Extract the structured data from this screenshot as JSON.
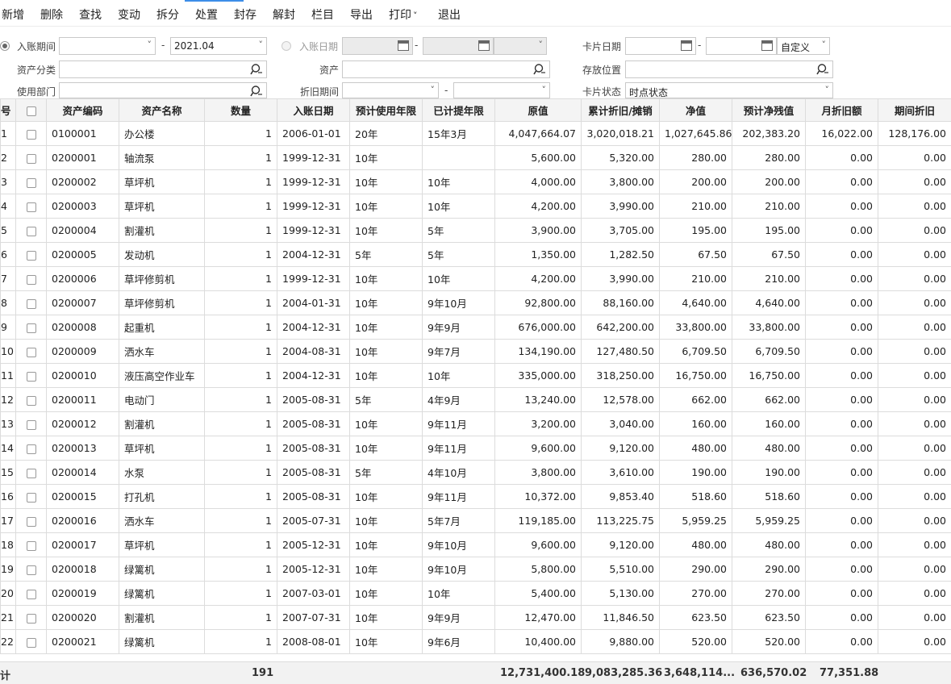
{
  "toolbar": {
    "add": "新增",
    "delete": "删除",
    "find": "查找",
    "change": "变动",
    "split": "拆分",
    "dispose": "处置",
    "seal": "封存",
    "unseal": "解封",
    "columns": "栏目",
    "export": "导出",
    "print": "打印",
    "exit": "退出"
  },
  "filters": {
    "entry_period_label": "入账期间",
    "entry_period_from": "",
    "entry_period_to": "2021.04",
    "entry_date_label": "入账日期",
    "entry_date_from": "",
    "entry_date_to": "",
    "card_date_label": "卡片日期",
    "card_date_from": "",
    "card_date_to": "",
    "card_date_mode": "自定义",
    "asset_category_label": "资产分类",
    "asset_category_value": "",
    "asset_label": "资产",
    "asset_value": "",
    "location_label": "存放位置",
    "location_value": "",
    "department_label": "使用部门",
    "department_value": "",
    "depr_period_label": "折旧期间",
    "depr_period_from": "",
    "depr_period_to": "",
    "card_status_label": "卡片状态",
    "card_status_value": "时点状态"
  },
  "table": {
    "headers": [
      "号",
      "",
      "资产编码",
      "资产名称",
      "数量",
      "入账日期",
      "预计使用年限",
      "已计提年限",
      "原值",
      "累计折旧/摊销",
      "净值",
      "预计净残值",
      "月折旧额",
      "期间折旧"
    ],
    "rows": [
      [
        "1",
        "0100001",
        "办公楼",
        "1",
        "2006-01-01",
        "20年",
        "15年3月",
        "4,047,664.07",
        "3,020,018.21",
        "1,027,645.86",
        "202,383.20",
        "16,022.00",
        "128,176.00"
      ],
      [
        "2",
        "0200001",
        "轴流泵",
        "1",
        "1999-12-31",
        "10年",
        "",
        "5,600.00",
        "5,320.00",
        "280.00",
        "280.00",
        "0.00",
        "0.00"
      ],
      [
        "3",
        "0200002",
        "草坪机",
        "1",
        "1999-12-31",
        "10年",
        "10年",
        "4,000.00",
        "3,800.00",
        "200.00",
        "200.00",
        "0.00",
        "0.00"
      ],
      [
        "4",
        "0200003",
        "草坪机",
        "1",
        "1999-12-31",
        "10年",
        "10年",
        "4,200.00",
        "3,990.00",
        "210.00",
        "210.00",
        "0.00",
        "0.00"
      ],
      [
        "5",
        "0200004",
        "割灌机",
        "1",
        "1999-12-31",
        "10年",
        "5年",
        "3,900.00",
        "3,705.00",
        "195.00",
        "195.00",
        "0.00",
        "0.00"
      ],
      [
        "6",
        "0200005",
        "发动机",
        "1",
        "2004-12-31",
        "5年",
        "5年",
        "1,350.00",
        "1,282.50",
        "67.50",
        "67.50",
        "0.00",
        "0.00"
      ],
      [
        "7",
        "0200006",
        "草坪修剪机",
        "1",
        "1999-12-31",
        "10年",
        "10年",
        "4,200.00",
        "3,990.00",
        "210.00",
        "210.00",
        "0.00",
        "0.00"
      ],
      [
        "8",
        "0200007",
        "草坪修剪机",
        "1",
        "2004-01-31",
        "10年",
        "9年10月",
        "92,800.00",
        "88,160.00",
        "4,640.00",
        "4,640.00",
        "0.00",
        "0.00"
      ],
      [
        "9",
        "0200008",
        "起重机",
        "1",
        "2004-12-31",
        "10年",
        "9年9月",
        "676,000.00",
        "642,200.00",
        "33,800.00",
        "33,800.00",
        "0.00",
        "0.00"
      ],
      [
        "10",
        "0200009",
        "洒水车",
        "1",
        "2004-08-31",
        "10年",
        "9年7月",
        "134,190.00",
        "127,480.50",
        "6,709.50",
        "6,709.50",
        "0.00",
        "0.00"
      ],
      [
        "11",
        "0200010",
        "液压高空作业车",
        "1",
        "2004-12-31",
        "10年",
        "10年",
        "335,000.00",
        "318,250.00",
        "16,750.00",
        "16,750.00",
        "0.00",
        "0.00"
      ],
      [
        "12",
        "0200011",
        "电动门",
        "1",
        "2005-08-31",
        "5年",
        "4年9月",
        "13,240.00",
        "12,578.00",
        "662.00",
        "662.00",
        "0.00",
        "0.00"
      ],
      [
        "13",
        "0200012",
        "割灌机",
        "1",
        "2005-08-31",
        "10年",
        "9年11月",
        "3,200.00",
        "3,040.00",
        "160.00",
        "160.00",
        "0.00",
        "0.00"
      ],
      [
        "14",
        "0200013",
        "草坪机",
        "1",
        "2005-08-31",
        "10年",
        "9年11月",
        "9,600.00",
        "9,120.00",
        "480.00",
        "480.00",
        "0.00",
        "0.00"
      ],
      [
        "15",
        "0200014",
        "水泵",
        "1",
        "2005-08-31",
        "5年",
        "4年10月",
        "3,800.00",
        "3,610.00",
        "190.00",
        "190.00",
        "0.00",
        "0.00"
      ],
      [
        "16",
        "0200015",
        "打孔机",
        "1",
        "2005-08-31",
        "10年",
        "9年11月",
        "10,372.00",
        "9,853.40",
        "518.60",
        "518.60",
        "0.00",
        "0.00"
      ],
      [
        "17",
        "0200016",
        "洒水车",
        "1",
        "2005-07-31",
        "10年",
        "5年7月",
        "119,185.00",
        "113,225.75",
        "5,959.25",
        "5,959.25",
        "0.00",
        "0.00"
      ],
      [
        "18",
        "0200017",
        "草坪机",
        "1",
        "2005-12-31",
        "10年",
        "9年10月",
        "9,600.00",
        "9,120.00",
        "480.00",
        "480.00",
        "0.00",
        "0.00"
      ],
      [
        "19",
        "0200018",
        "绿篱机",
        "1",
        "2005-12-31",
        "10年",
        "9年10月",
        "5,800.00",
        "5,510.00",
        "290.00",
        "290.00",
        "0.00",
        "0.00"
      ],
      [
        "20",
        "0200019",
        "绿篱机",
        "1",
        "2007-03-01",
        "10年",
        "10年",
        "5,400.00",
        "5,130.00",
        "270.00",
        "270.00",
        "0.00",
        "0.00"
      ],
      [
        "21",
        "0200020",
        "割灌机",
        "1",
        "2007-07-31",
        "10年",
        "9年9月",
        "12,470.00",
        "11,846.50",
        "623.50",
        "623.50",
        "0.00",
        "0.00"
      ],
      [
        "22",
        "0200021",
        "绿篱机",
        "1",
        "2008-08-01",
        "10年",
        "9年6月",
        "10,400.00",
        "9,880.00",
        "520.00",
        "520.00",
        "0.00",
        "0.00"
      ]
    ]
  },
  "footer": {
    "label": "计",
    "quantity": "191",
    "original_value": "12,731,400.18",
    "accumulated": "9,083,285.36",
    "net_value": "3,648,114...",
    "residual": "636,570.02",
    "monthly": "77,351.88"
  }
}
